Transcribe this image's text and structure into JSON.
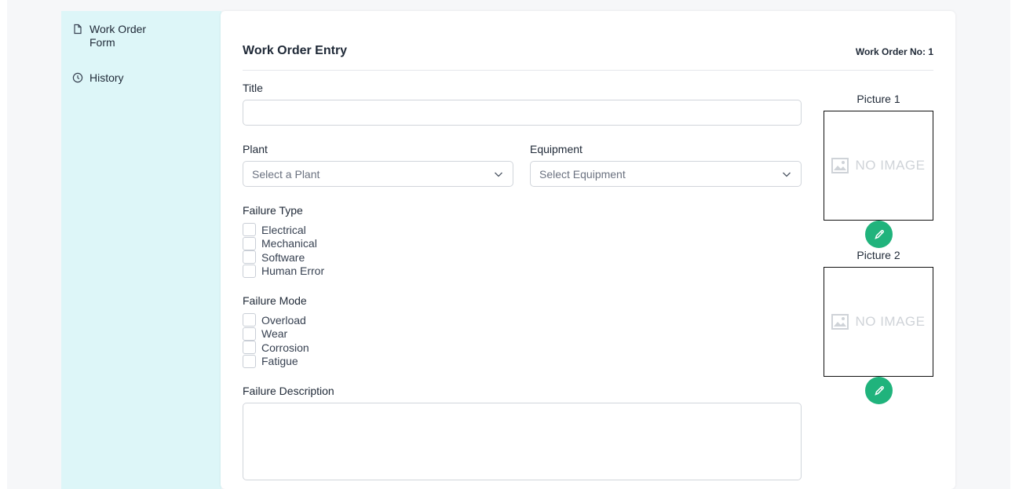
{
  "sidebar": {
    "items": [
      {
        "label": "Work Order Form",
        "icon": "document-icon"
      },
      {
        "label": "History",
        "icon": "clock-icon"
      }
    ]
  },
  "header": {
    "title": "Work Order Entry",
    "work_order_no": "Work Order No: 1"
  },
  "form": {
    "title_label": "Title",
    "title_value": "",
    "plant_label": "Plant",
    "plant_placeholder": "Select a Plant",
    "equipment_label": "Equipment",
    "equipment_placeholder": "Select Equipment",
    "failure_type_label": "Failure Type",
    "failure_types": [
      "Electrical",
      "Mechanical",
      "Software",
      "Human Error"
    ],
    "failure_mode_label": "Failure Mode",
    "failure_modes": [
      "Overload",
      "Wear",
      "Corrosion",
      "Fatigue"
    ],
    "description_label": "Failure Description",
    "description_value": ""
  },
  "pictures": [
    {
      "label": "Picture 1",
      "placeholder": "NO IMAGE"
    },
    {
      "label": "Picture 2",
      "placeholder": "NO IMAGE"
    }
  ],
  "colors": {
    "sidebar_bg": "#ddf6f8",
    "accent_green": "#20b37c"
  }
}
